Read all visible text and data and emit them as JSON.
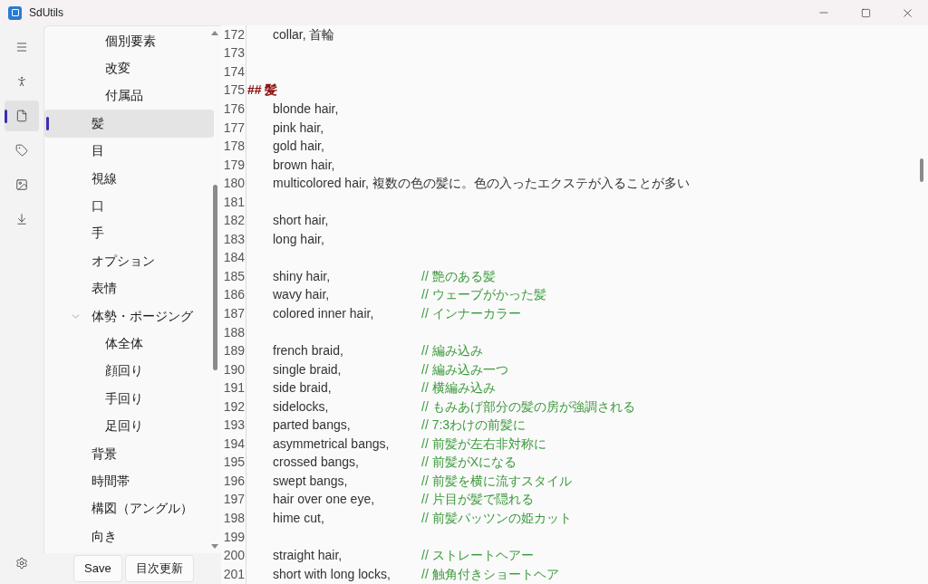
{
  "window": {
    "title": "SdUtils"
  },
  "nav_rail": [
    {
      "selected": false
    },
    {
      "selected": false
    },
    {
      "selected": true
    },
    {
      "selected": false
    },
    {
      "selected": false
    },
    {
      "selected": false
    }
  ],
  "tree": {
    "items": [
      {
        "children": [
          {
            "label": "個別要素",
            "selected": false
          },
          {
            "label": "改変",
            "selected": false
          },
          {
            "label": "付属品",
            "selected": false
          }
        ]
      },
      {
        "label": "髪",
        "selected": true
      },
      {
        "label": "目",
        "selected": false
      },
      {
        "label": "視線",
        "selected": false
      },
      {
        "label": "口",
        "selected": false
      },
      {
        "label": "手",
        "selected": false
      },
      {
        "label": "オプション",
        "selected": false
      },
      {
        "label": "表情",
        "selected": false
      },
      {
        "label": "体勢・ポージング",
        "selected": false,
        "expanded": true,
        "children": [
          {
            "label": "体全体",
            "selected": false
          },
          {
            "label": "顔回り",
            "selected": false
          },
          {
            "label": "手回り",
            "selected": false
          },
          {
            "label": "足回り",
            "selected": false
          }
        ]
      },
      {
        "label": "背景",
        "selected": false
      },
      {
        "label": "時間帯",
        "selected": false
      },
      {
        "label": "構図（アングル）",
        "selected": false
      },
      {
        "label": "向き",
        "selected": false
      }
    ]
  },
  "buttons": [
    "Save",
    "目次更新"
  ],
  "editor": {
    "lines": [
      {
        "number": "172",
        "kind": "code",
        "code": "collar, 首輪"
      },
      {
        "number": "173",
        "kind": "blank"
      },
      {
        "number": "174",
        "kind": "blank"
      },
      {
        "number": "175",
        "kind": "heading",
        "code": "## 髪"
      },
      {
        "number": "176",
        "kind": "code",
        "code": "blonde hair,"
      },
      {
        "number": "177",
        "kind": "code",
        "code": "pink hair,"
      },
      {
        "number": "178",
        "kind": "code",
        "code": "gold hair,"
      },
      {
        "number": "179",
        "kind": "code",
        "code": "brown hair,"
      },
      {
        "number": "180",
        "kind": "code",
        "code": "multicolored hair, 複数の色の髪に。色の入ったエクステが入ることが多い"
      },
      {
        "number": "181",
        "kind": "blank"
      },
      {
        "number": "182",
        "kind": "code",
        "code": "short hair,"
      },
      {
        "number": "183",
        "kind": "code",
        "code": "long hair,"
      },
      {
        "number": "184",
        "kind": "blank"
      },
      {
        "number": "185",
        "kind": "code",
        "code": "shiny hair,",
        "comment": "// 艶のある髪"
      },
      {
        "number": "186",
        "kind": "code",
        "code": "wavy hair,",
        "comment": "// ウェーブがかった髪"
      },
      {
        "number": "187",
        "kind": "code",
        "code": "colored inner hair,",
        "comment": "// インナーカラー"
      },
      {
        "number": "188",
        "kind": "blank"
      },
      {
        "number": "189",
        "kind": "code",
        "code": "french braid,",
        "comment": "// 編み込み"
      },
      {
        "number": "190",
        "kind": "code",
        "code": "single braid,",
        "comment": "// 編み込み一つ"
      },
      {
        "number": "191",
        "kind": "code",
        "code": "side braid,",
        "comment": "// 横編み込み"
      },
      {
        "number": "192",
        "kind": "code",
        "code": "sidelocks,",
        "comment": "// もみあげ部分の髪の房が強調される"
      },
      {
        "number": "193",
        "kind": "code",
        "code": "parted bangs,",
        "comment": "// 7:3わけの前髪に"
      },
      {
        "number": "194",
        "kind": "code",
        "code": "asymmetrical bangs,",
        "comment": "// 前髪が左右非対称に"
      },
      {
        "number": "195",
        "kind": "code",
        "code": "crossed bangs,",
        "comment": "// 前髪がXになる"
      },
      {
        "number": "196",
        "kind": "code",
        "code": "swept bangs,",
        "comment": "// 前髪を横に流すスタイル"
      },
      {
        "number": "197",
        "kind": "code",
        "code": "hair over one eye,",
        "comment": "// 片目が髪で隠れる"
      },
      {
        "number": "198",
        "kind": "code",
        "code": "hime cut,",
        "comment": "// 前髪パッツンの姫カット"
      },
      {
        "number": "199",
        "kind": "blank"
      },
      {
        "number": "200",
        "kind": "code",
        "code": "straight hair,",
        "comment": "// ストレートヘアー"
      },
      {
        "number": "201",
        "kind": "code",
        "code": "short with long locks,",
        "comment": "// 触角付きショートヘア"
      }
    ]
  }
}
